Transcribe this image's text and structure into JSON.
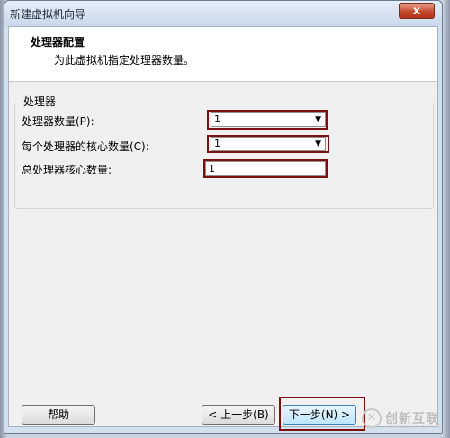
{
  "window": {
    "title": "新建虚拟机向导",
    "close_glyph": "x"
  },
  "header": {
    "title": "处理器配置",
    "subtitle": "为此虚拟机指定处理器数量。"
  },
  "processor_group": {
    "legend": "处理器",
    "processor_count_label": "处理器数量(P):",
    "processor_count_value": "1",
    "cores_per_processor_label": "每个处理器的核心数量(C):",
    "cores_per_processor_value": "1",
    "total_cores_label": "总处理器核心数量:",
    "total_cores_value": "1"
  },
  "buttons": {
    "help": "帮助",
    "back": "< 上一步(B)",
    "next": "下一步(N) >"
  },
  "watermark": {
    "text": "创新互联",
    "sub": "CHUANG XIN HU LIAN"
  },
  "colors": {
    "highlight": "#7a1010",
    "close_button": "#c44a2e"
  }
}
